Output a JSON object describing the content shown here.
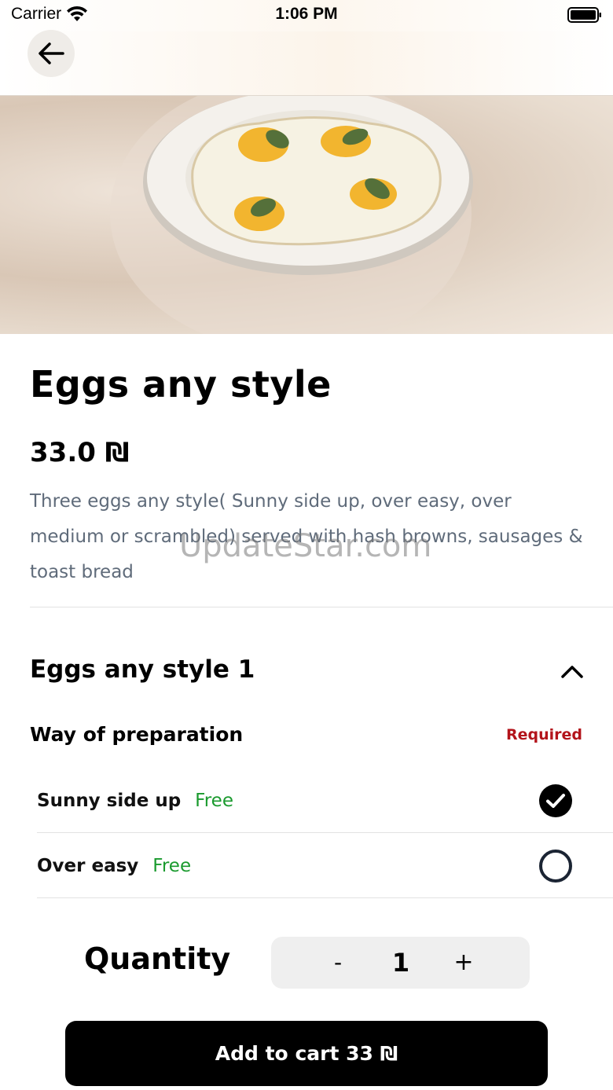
{
  "status_bar": {
    "carrier": "Carrier",
    "time": "1:06 PM"
  },
  "product": {
    "title": "Eggs any style",
    "price": "33.0 ₪",
    "description": "Three eggs any style( Sunny side up, over easy, over medium or scrambled) served with hash browns, sausages & toast bread"
  },
  "watermark": "UpdateStar.com",
  "options_section": {
    "title": "Eggs any style 1",
    "group_label": "Way of preparation",
    "required_label": "Required",
    "options": [
      {
        "name": "Sunny side up",
        "price": "Free",
        "selected": true
      },
      {
        "name": "Over easy",
        "price": "Free",
        "selected": false
      }
    ]
  },
  "quantity": {
    "label": "Quantity",
    "minus": "-",
    "value": "1",
    "plus": "+"
  },
  "cart_button": {
    "label": "Add to cart 33 ₪"
  },
  "colors": {
    "required": "#b3141b",
    "free": "#1a9a2e",
    "description": "#5f6b7a",
    "cart_bg": "#000000"
  }
}
